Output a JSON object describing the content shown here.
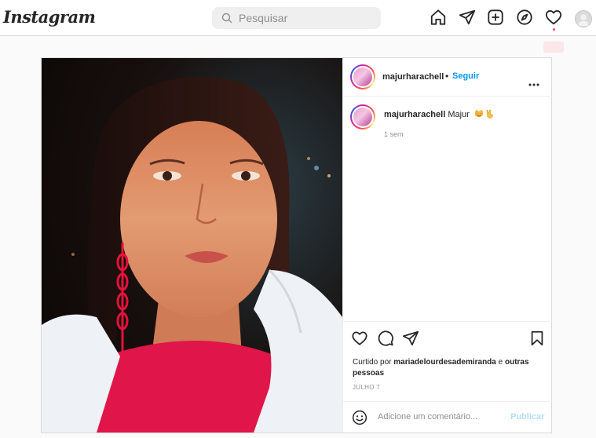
{
  "nav": {
    "logo": "Instagram",
    "search_placeholder": "Pesquisar",
    "icons": [
      "home-icon",
      "direct-icon",
      "new-post-icon",
      "explore-icon",
      "activity-icon",
      "profile-avatar"
    ]
  },
  "post": {
    "username": "majurharachell",
    "follow_label": "Seguir",
    "separator": "•",
    "caption_username": "majurharachell",
    "caption_text": "Majur",
    "caption_emojis": [
      "smiling-cat-heart-eyes-emoji",
      "victory-hand-emoji"
    ],
    "caption_time": "1 sem",
    "liked_prefix": "Curtido por ",
    "liked_user": "mariadelourdesademiranda",
    "liked_and": " e ",
    "liked_others": "outras pessoas",
    "date": "JULHO 7",
    "comment_placeholder": "Adicione um comentário...",
    "publish_label": "Publicar"
  },
  "colors": {
    "accent": "#0095f6",
    "publish_disabled": "#b2dffc",
    "notification": "#ed4956"
  }
}
